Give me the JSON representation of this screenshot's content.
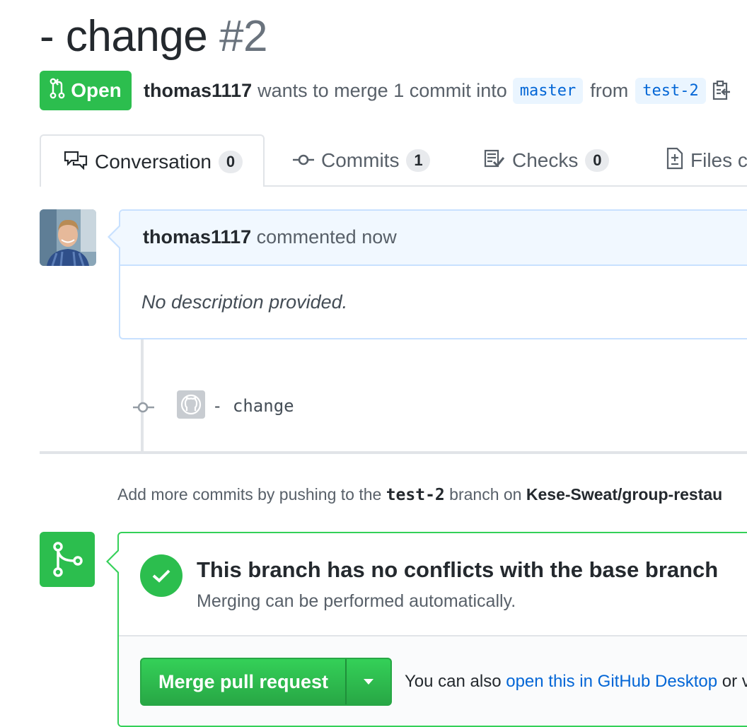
{
  "pr": {
    "title": "- change",
    "number": "#2",
    "state": "Open",
    "author": "thomas1117",
    "merge_text": "wants to merge 1 commit into",
    "base_branch": "master",
    "from_text": "from",
    "head_branch": "test-2"
  },
  "tabs": [
    {
      "label": "Conversation",
      "count": "0"
    },
    {
      "label": "Commits",
      "count": "1"
    },
    {
      "label": "Checks",
      "count": "0"
    },
    {
      "label": "Files cl",
      "count": ""
    }
  ],
  "comment": {
    "author": "thomas1117",
    "action": "commented now",
    "body": "No description provided."
  },
  "commit": {
    "message": "- change"
  },
  "push_note": {
    "prefix": "Add more commits by pushing to the",
    "branch": "test-2",
    "middle": "branch on",
    "repo": "Kese-Sweat/group-restau"
  },
  "merge": {
    "title": "This branch has no conflicts with the base branch",
    "subtitle": "Merging can be performed automatically.",
    "button_label": "Merge pull request",
    "also_prefix": "You can also",
    "also_link": "open this in GitHub Desktop",
    "also_suffix": "or v"
  },
  "colors": {
    "green": "#2cbe4e",
    "link": "#0366d6",
    "comment_border": "#c8e1ff"
  }
}
